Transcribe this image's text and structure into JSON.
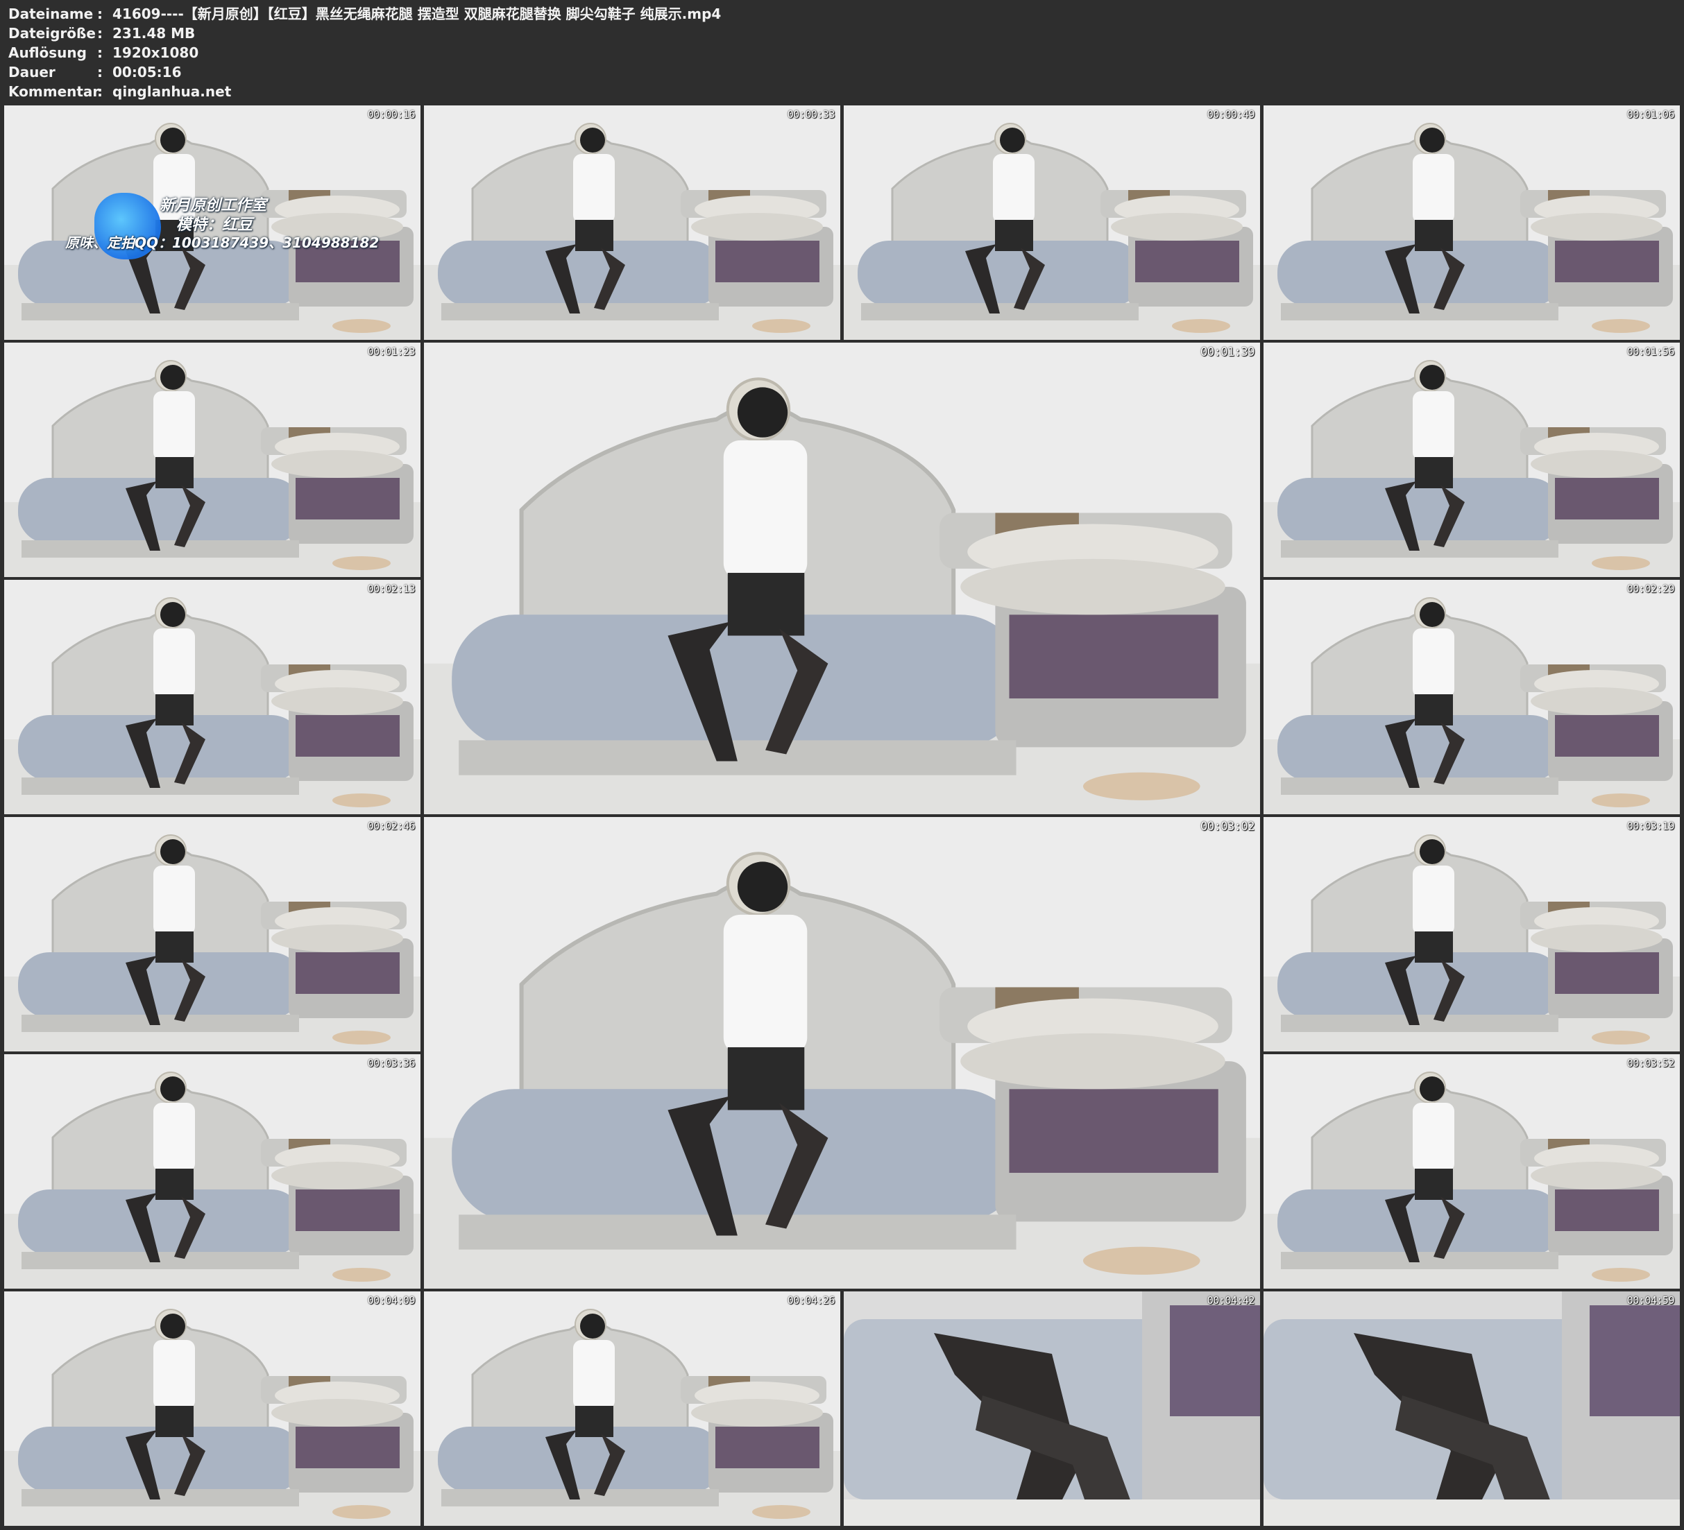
{
  "header": {
    "rows": [
      {
        "label": "Dateiname",
        "value": "41609----【新月原创】【红豆】黑丝无绳麻花腿 摆造型 双腿麻花腿替换 脚尖勾鞋子 纯展示.mp4"
      },
      {
        "label": "Dateigröße",
        "value": "231.48 MB"
      },
      {
        "label": "Auflösung",
        "value": "1920x1080"
      },
      {
        "label": "Dauer",
        "value": "00:05:16"
      },
      {
        "label": "Kommentar",
        "value": "qinglanhua.net"
      }
    ],
    "separator": ":"
  },
  "watermark": {
    "line1": "新月原创工作室",
    "line2": "模特：红豆",
    "line3": "原味、定拍QQ：1003187439、3104988182"
  },
  "thumbnails": [
    {
      "timestamp": "00:00:16"
    },
    {
      "timestamp": "00:00:33"
    },
    {
      "timestamp": "00:00:49"
    },
    {
      "timestamp": "00:01:06"
    },
    {
      "timestamp": "00:01:23"
    },
    {
      "timestamp": "00:01:39"
    },
    {
      "timestamp": "00:01:56"
    },
    {
      "timestamp": "00:02:13"
    },
    {
      "timestamp": "00:02:29"
    },
    {
      "timestamp": "00:02:46"
    },
    {
      "timestamp": "00:03:02"
    },
    {
      "timestamp": "00:03:19"
    },
    {
      "timestamp": "00:03:36"
    },
    {
      "timestamp": "00:03:52"
    },
    {
      "timestamp": "00:04:09"
    },
    {
      "timestamp": "00:04:26"
    },
    {
      "timestamp": "00:04:42"
    },
    {
      "timestamp": "00:04:59"
    }
  ],
  "colors": {
    "background": "#2e2e2e",
    "header_text": "#f2f2f2",
    "timestamp_text": "#ffffff",
    "watermark_blob": "#1a73e8"
  }
}
